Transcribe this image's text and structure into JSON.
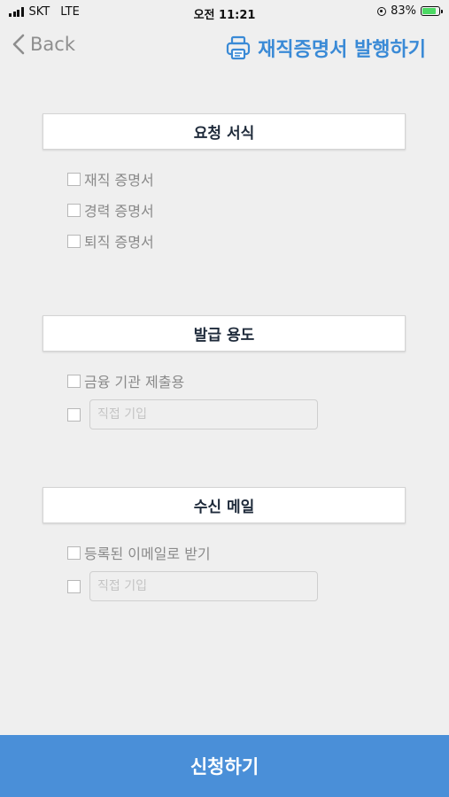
{
  "status_bar": {
    "carrier": "SKT",
    "network": "LTE",
    "time": "오전 11:21",
    "battery": "83%",
    "battery_level": 0.83
  },
  "nav": {
    "back_label": "Back",
    "title": "재직증명서 발행하기",
    "accent_color": "#3a8ad6"
  },
  "request_form": {
    "header": "요청 서식",
    "options": [
      "재직 증명서",
      "경력 증명서",
      "퇴직 증명서"
    ]
  },
  "purpose": {
    "header": "발급 용도",
    "options": [
      "금융 기관 제출용"
    ],
    "direct_input_placeholder": "직접 기입"
  },
  "receive_mail": {
    "header": "수신 메일",
    "options": [
      "등록된 이메일로 받기"
    ],
    "direct_input_placeholder": "직접 기입"
  },
  "submit_label": "신청하기",
  "submit_color": "#4a8fd8"
}
